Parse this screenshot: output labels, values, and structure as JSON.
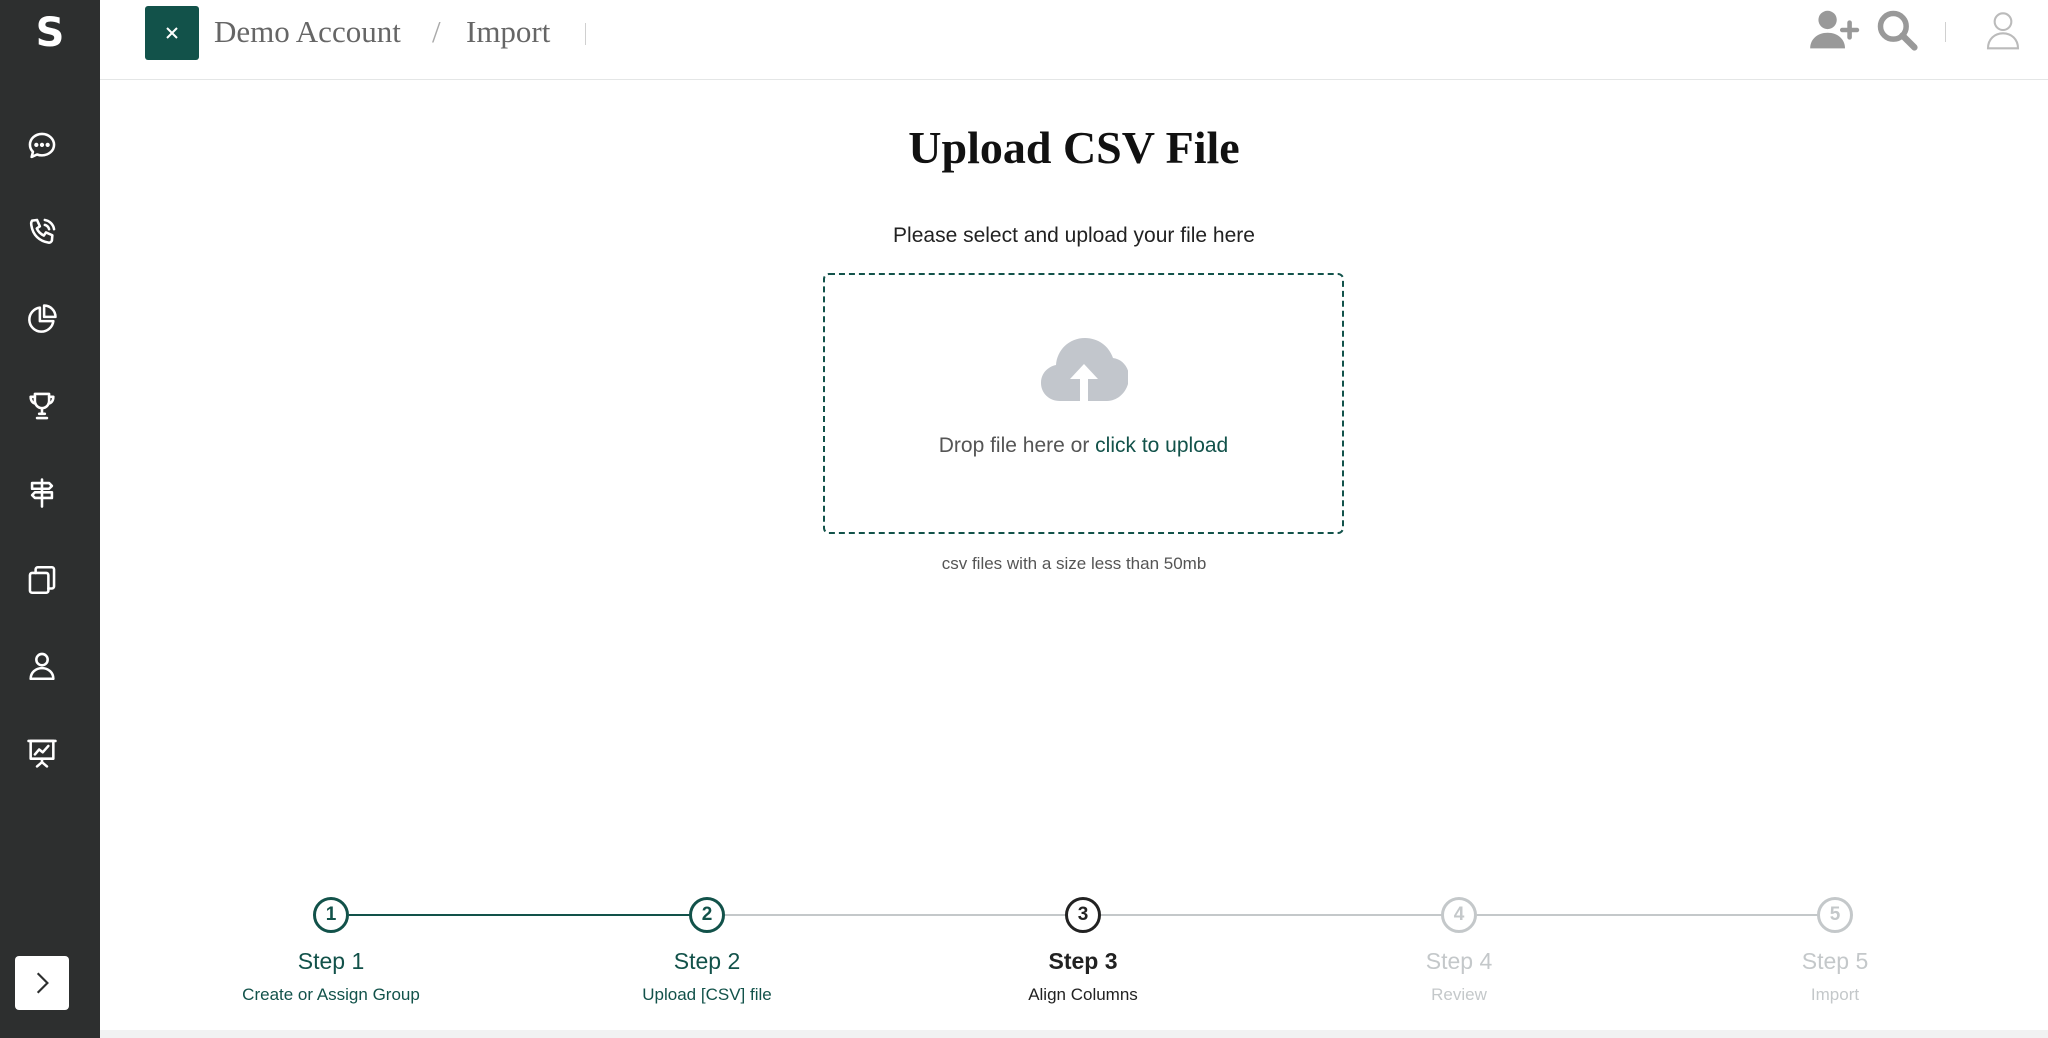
{
  "app": {
    "logo_letter": "S"
  },
  "sidebar": {
    "items": [
      {
        "name": "messages",
        "icon": "chat-bubble-icon"
      },
      {
        "name": "calls",
        "icon": "phone-icon"
      },
      {
        "name": "analytics",
        "icon": "pie-chart-icon"
      },
      {
        "name": "achievements",
        "icon": "trophy-icon"
      },
      {
        "name": "routing",
        "icon": "signpost-icon"
      },
      {
        "name": "templates",
        "icon": "copy-icon"
      },
      {
        "name": "contacts",
        "icon": "user-icon"
      },
      {
        "name": "reports",
        "icon": "presentation-chart-icon"
      }
    ],
    "expand_icon": "chevron-right-icon"
  },
  "header": {
    "breadcrumb": {
      "account": "Demo Account",
      "separator": "/",
      "page": "Import"
    },
    "icons": [
      "add-user-icon",
      "search-icon",
      "profile-icon"
    ]
  },
  "main": {
    "title": "Upload CSV File",
    "subtitle": "Please select and upload your file here",
    "dropzone": {
      "text": "Drop file here or ",
      "link": "click to upload",
      "icon": "cloud-upload-icon"
    },
    "hint": "csv files with a size less than 50mb"
  },
  "stepper": {
    "steps": [
      {
        "number": "1",
        "title": "Step 1",
        "description": "Create or Assign Group",
        "state": "done"
      },
      {
        "number": "2",
        "title": "Step 2",
        "description": "Upload [CSV] file",
        "state": "done"
      },
      {
        "number": "3",
        "title": "Step 3",
        "description": "Align Columns",
        "state": "current"
      },
      {
        "number": "4",
        "title": "Step 4",
        "description": "Review",
        "state": "pending"
      },
      {
        "number": "5",
        "title": "Step 5",
        "description": "Import",
        "state": "pending"
      }
    ]
  },
  "colors": {
    "sidebar": "#2d2f2f",
    "accent": "#12524a",
    "pending": "#c4c8ca",
    "current": "#222222"
  }
}
